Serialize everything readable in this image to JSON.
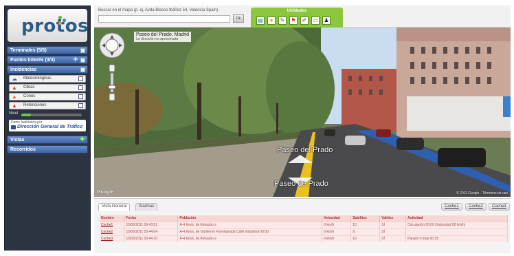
{
  "sidebar": {
    "logo": "protos",
    "sections": {
      "terminales": "Terminales (5/5)",
      "puntos": "Puntos Interés (3/3)",
      "incidencias": "Incidencias",
      "vistas": "Vistas",
      "recorridos": "Recorridos"
    },
    "incidencias": [
      {
        "label": "Meteorológicas",
        "icon": "weather-icon"
      },
      {
        "label": "Obras",
        "icon": "roadwork-icon"
      },
      {
        "label": "Conos",
        "icon": "cone-icon"
      },
      {
        "label": "Retenciones",
        "icon": "traffic-icon"
      }
    ],
    "nivel_label": "Nivel",
    "dgt_small": "Datos facilitados por",
    "dgt_big": "Dirección General de Tráfico"
  },
  "topbar": {
    "search_label": "Buscar en el mapa (p. ej. Avda Blasco Ibáñez 54, Valencia Spain)",
    "search_value": "",
    "search_button": "Ok",
    "tools_title": "Utilidades"
  },
  "streetview": {
    "address": "Paseo del Prado, Madrid",
    "address_note": "La dirección es aproximada",
    "road_label_1": "Paseo del Prado",
    "road_label_2": "Paseo de Prado",
    "copyright": "© 2011 Google - Términos de uso",
    "google_logo": "Google"
  },
  "bottom": {
    "tabs": [
      "Vista General",
      "Alarmas"
    ],
    "right_tabs": [
      "Coche1",
      "Coche2",
      "Coche3"
    ],
    "columns": [
      "Nombre",
      "Fecha",
      "Población",
      "Velocidad",
      "Satélites",
      "Validez",
      "Actividad"
    ],
    "rows": [
      {
        "nombre": "Coche1",
        "fecha": "15/06/2011 09:43:51",
        "poblacion": "A-4 Km/s, de Almazán s",
        "velocidad": "0 km/h",
        "satelites": "10",
        "validez": "SÍ",
        "actividad": "Circulación 00:00 (Velocidad 00 km/h)"
      },
      {
        "nombre": "Coche2",
        "fecha": "15/06/2011 09:44:04",
        "poblacion": "A-4 Km/s, de Guillermo Fuenlabrada Calle Industrial 00:00",
        "velocidad": "0 km/h",
        "satelites": "9",
        "validez": "SÍ",
        "actividad": ""
      },
      {
        "nombre": "Coche3",
        "fecha": "15/06/2011 09:44:10",
        "poblacion": "A-4 Km/s, de Almazán s",
        "velocidad": "0 km/h",
        "satelites": "10",
        "validez": "SÍ",
        "actividad": "Parado 0 días 00:35"
      }
    ]
  }
}
